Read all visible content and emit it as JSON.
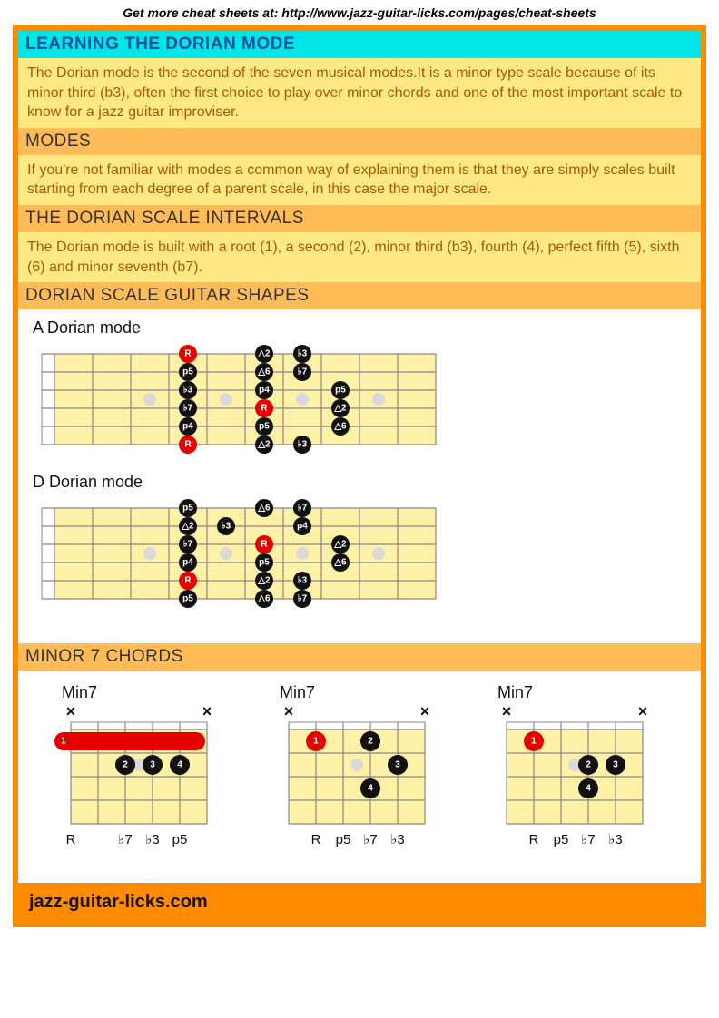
{
  "topbar": "Get more cheat sheets at: http://www.jazz-guitar-licks.com/pages/cheat-sheets",
  "title": "LEARNING THE DORIAN MODE",
  "intro": "The Dorian mode is the second of the seven musical modes.It is a minor type scale because of its minor third (b3), often the first choice to play over minor chords and one of the most important scale to know for a jazz guitar improviser.",
  "modes_hdr": "MODES",
  "modes_body": "If you're not familiar with modes a common way of explaining them is that they are simply scales built starting from each degree of a parent scale, in this case the major scale.",
  "intervals_hdr": "THE DORIAN SCALE INTERVALS",
  "intervals_body": "The Dorian mode is built with a root (1), a second (2), minor third (b3), fourth (4), perfect fifth (5), sixth (6) and minor seventh (b7).",
  "shapes_hdr": "DORIAN SCALE GUITAR SHAPES",
  "shapeA_title": "A Dorian mode",
  "shapeD_title": "D Dorian mode",
  "chords_hdr": "MINOR 7 CHORDS",
  "chord_label": "Min7",
  "footer": "jazz-guitar-licks.com",
  "shapeA": {
    "strings": 6,
    "frets": 10,
    "startFret": 1,
    "inlays": [
      3,
      5,
      7,
      9
    ],
    "notes": [
      {
        "s": 1,
        "f": 4,
        "t": "R",
        "root": true
      },
      {
        "s": 1,
        "f": 6,
        "t": "△2"
      },
      {
        "s": 1,
        "f": 7,
        "t": "♭3"
      },
      {
        "s": 2,
        "f": 4,
        "t": "p5"
      },
      {
        "s": 2,
        "f": 6,
        "t": "△6"
      },
      {
        "s": 2,
        "f": 7,
        "t": "♭7"
      },
      {
        "s": 3,
        "f": 4,
        "t": "♭3"
      },
      {
        "s": 3,
        "f": 6,
        "t": "p4"
      },
      {
        "s": 3,
        "f": 8,
        "t": "p5"
      },
      {
        "s": 4,
        "f": 4,
        "t": "♭7"
      },
      {
        "s": 4,
        "f": 6,
        "t": "R",
        "root": true
      },
      {
        "s": 4,
        "f": 8,
        "t": "△2"
      },
      {
        "s": 5,
        "f": 4,
        "t": "p4"
      },
      {
        "s": 5,
        "f": 6,
        "t": "p5"
      },
      {
        "s": 5,
        "f": 8,
        "t": "△6"
      },
      {
        "s": 6,
        "f": 4,
        "t": "R",
        "root": true
      },
      {
        "s": 6,
        "f": 6,
        "t": "△2"
      },
      {
        "s": 6,
        "f": 7,
        "t": "♭3"
      }
    ]
  },
  "shapeD": {
    "strings": 6,
    "frets": 10,
    "startFret": 1,
    "inlays": [
      3,
      5,
      7,
      9
    ],
    "notes": [
      {
        "s": 1,
        "f": 4,
        "t": "p5"
      },
      {
        "s": 1,
        "f": 6,
        "t": "△6"
      },
      {
        "s": 1,
        "f": 7,
        "t": "♭7"
      },
      {
        "s": 2,
        "f": 4,
        "t": "△2"
      },
      {
        "s": 2,
        "f": 5,
        "t": "♭3"
      },
      {
        "s": 2,
        "f": 7,
        "t": "p4"
      },
      {
        "s": 3,
        "f": 4,
        "t": "♭7"
      },
      {
        "s": 3,
        "f": 6,
        "t": "R",
        "root": true
      },
      {
        "s": 3,
        "f": 8,
        "t": "△2"
      },
      {
        "s": 4,
        "f": 4,
        "t": "p4"
      },
      {
        "s": 4,
        "f": 6,
        "t": "p5"
      },
      {
        "s": 4,
        "f": 8,
        "t": "△6"
      },
      {
        "s": 5,
        "f": 4,
        "t": "R",
        "root": true
      },
      {
        "s": 5,
        "f": 6,
        "t": "△2"
      },
      {
        "s": 5,
        "f": 7,
        "t": "♭3"
      },
      {
        "s": 6,
        "f": 4,
        "t": "p5"
      },
      {
        "s": 6,
        "f": 6,
        "t": "△6"
      },
      {
        "s": 6,
        "f": 7,
        "t": "♭7"
      }
    ]
  },
  "chords": [
    {
      "name": "Min7",
      "mutes": [
        1,
        6
      ],
      "barre": {
        "fret": 1,
        "from": 1,
        "to": 6,
        "finger": "1"
      },
      "dots": [
        {
          "s": 3,
          "f": 2,
          "t": "2"
        },
        {
          "s": 4,
          "f": 2,
          "t": "3"
        },
        {
          "s": 5,
          "f": 2,
          "t": "4"
        }
      ],
      "under": [
        "R",
        "",
        "♭7",
        "♭3",
        "p5",
        ""
      ]
    },
    {
      "name": "Min7",
      "mutes": [
        1,
        6
      ],
      "barre": {
        "fret": 1,
        "from": 2,
        "to": 4,
        "finger": "1"
      },
      "dots": [
        {
          "s": 3,
          "f": 1,
          "t": "2",
          "alone": true
        },
        {
          "s": 4,
          "f": 2,
          "t": "3"
        },
        {
          "s": 5,
          "f": 3,
          "t": "4"
        }
      ],
      "under": [
        "",
        "R",
        "p5",
        "♭7",
        "♭3",
        ""
      ]
    },
    {
      "name": "Min7",
      "mutes": [
        1,
        6
      ],
      "barre": {
        "fret": 1,
        "from": 2,
        "to": 5,
        "finger": "1"
      },
      "dots": [
        {
          "s": 4,
          "f": 2,
          "t": "2"
        },
        {
          "s": 5,
          "f": 2,
          "t": "3"
        },
        {
          "s": 4,
          "f": 3,
          "t": "4",
          "below": true
        }
      ],
      "under": [
        "",
        "R",
        "p5",
        "♭7",
        "♭3",
        ""
      ],
      "variant": 3
    }
  ]
}
